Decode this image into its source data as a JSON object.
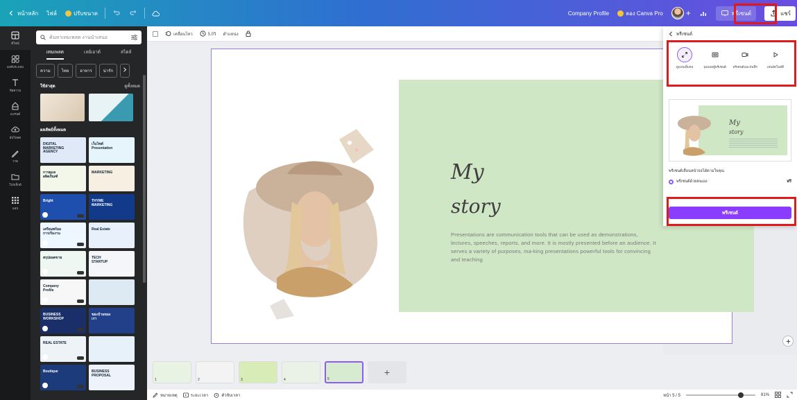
{
  "topbar": {
    "home_label": "หน้าหลัก",
    "file_label": "ไฟล์",
    "resize_label": "ปรับขนาด",
    "doc_title": "Company Profile",
    "try_pro_label": "ลอง Canva Pro",
    "present_label": "พรีเซนต์",
    "share_label": "แชร์"
  },
  "rail": {
    "items": [
      {
        "label": "ดีไซน์",
        "icon": "layout-icon"
      },
      {
        "label": "องค์ประกอบ",
        "icon": "elements-icon"
      },
      {
        "label": "ข้อความ",
        "icon": "text-icon"
      },
      {
        "label": "แบรนด์",
        "icon": "brand-icon"
      },
      {
        "label": "อัปโหลด",
        "icon": "upload-icon"
      },
      {
        "label": "วาด",
        "icon": "draw-icon"
      },
      {
        "label": "โปรเจ็กต์",
        "icon": "folder-icon"
      },
      {
        "label": "แอป",
        "icon": "apps-icon"
      }
    ]
  },
  "panel": {
    "search_placeholder": "ค้นหาเทมเพลต งานนำเสนอ",
    "tabs": [
      "เทมเพลต",
      "เลย์เอาต์",
      "สไตล์"
    ],
    "chips": [
      "ความ",
      "ไทย",
      "อาหาร",
      "น่ารัก"
    ],
    "recent_title": "ใช้ล่าสุด",
    "see_all": "ดูทั้งหมด",
    "all_results_title": "ผลลัพธ์ทั้งหมด",
    "templates": [
      {
        "title": "DIGITAL MARKETING AGENCY",
        "bg": "#dfe9f7"
      },
      {
        "title": "เว็บไซต์ Presentation",
        "bg": "#e6f5fb"
      },
      {
        "title": "การดูแลผลิตภัณฑ์",
        "bg": "#f2f7ea"
      },
      {
        "title": "MARKETING",
        "bg": "#f6efe2"
      },
      {
        "title": "Bright",
        "bg": "#1f4fae"
      },
      {
        "title": "THYME MARKETING",
        "bg": "#123a8a"
      },
      {
        "title": "เตรียมพร้อมการเริ่มงาน",
        "bg": "#eef6ff"
      },
      {
        "title": "Real Estate",
        "bg": "#e8f1fb"
      },
      {
        "title": "สรุปยอดขาย",
        "bg": "#eef7f2"
      },
      {
        "title": "TECH STARTUP",
        "bg": "#f4f6fa"
      },
      {
        "title": "Company Profile",
        "bg": "#f7f7f7"
      },
      {
        "title": "",
        "bg": "#dde9f3"
      },
      {
        "title": "BUSINESS WORKSHOP",
        "bg": "#1a2f6a"
      },
      {
        "title": "ขยะบ้านของเรา",
        "bg": "#223f8a"
      },
      {
        "title": "REAL ESTATE",
        "bg": "#eef3f7"
      },
      {
        "title": "",
        "bg": "#e7f1f9"
      },
      {
        "title": "Boutique",
        "bg": "#1c3b7a"
      },
      {
        "title": "BUSINESS PROPOSAL",
        "bg": "#eef2fb"
      }
    ]
  },
  "toolbar2": {
    "animate_label": "เคลื่อนไหว",
    "timing_label": "5.0วิ",
    "position_label": "ตำแหน่ง"
  },
  "slide": {
    "title_line1": "My",
    "title_line2": "story",
    "body": "Presentations are communication tools that can be used as demonstrations, lectures, speeches, reports, and more. It is mostly presented before an audience. It serves a variety of purposes, ma-king presentations powerful tools for convincing and teaching"
  },
  "pages": {
    "items": [
      {
        "n": "1",
        "bg": "#e9f3e4"
      },
      {
        "n": "2",
        "bg": "#f3f3f3"
      },
      {
        "n": "3",
        "bg": "#d8ecb8"
      },
      {
        "n": "4",
        "bg": "#eaf1e6"
      },
      {
        "n": "5",
        "bg": "#d6ebcf"
      }
    ],
    "add_label": "+"
  },
  "footer": {
    "notes_label": "หมายเหตุ",
    "duration_label": "ระยะเวลา",
    "timer_label": "ตัวจับเวลา",
    "page_label": "หน้า 5 / 5",
    "zoom_label": "81%",
    "zoom_value": 0.81
  },
  "dropdown": {
    "back_label": "พรีเซนต์",
    "modes": [
      {
        "label": "ดูแบบเต็มจอ",
        "icon": "fullscreen-icon"
      },
      {
        "label": "มุมมองผู้พรีเซนต์",
        "icon": "presenter-view-icon"
      },
      {
        "label": "พรีเซนต์และบันทึก",
        "icon": "record-icon"
      },
      {
        "label": "เล่นอัตโนมัติ",
        "icon": "autoplay-icon"
      }
    ],
    "preview_title_1": "My",
    "preview_title_2": "story",
    "options_title": "พรีเซนต์เลื่อนหน้าจอได้ตามใจคุณ",
    "option_label": "พรีเซนต์ด้วยตนเอง",
    "option_value": "ฟรี",
    "present_button": "พรีเซนต์"
  },
  "colors": {
    "accent": "#8b3dff",
    "highlight": "#e01a1a",
    "slide_green": "#cfe7c5"
  }
}
